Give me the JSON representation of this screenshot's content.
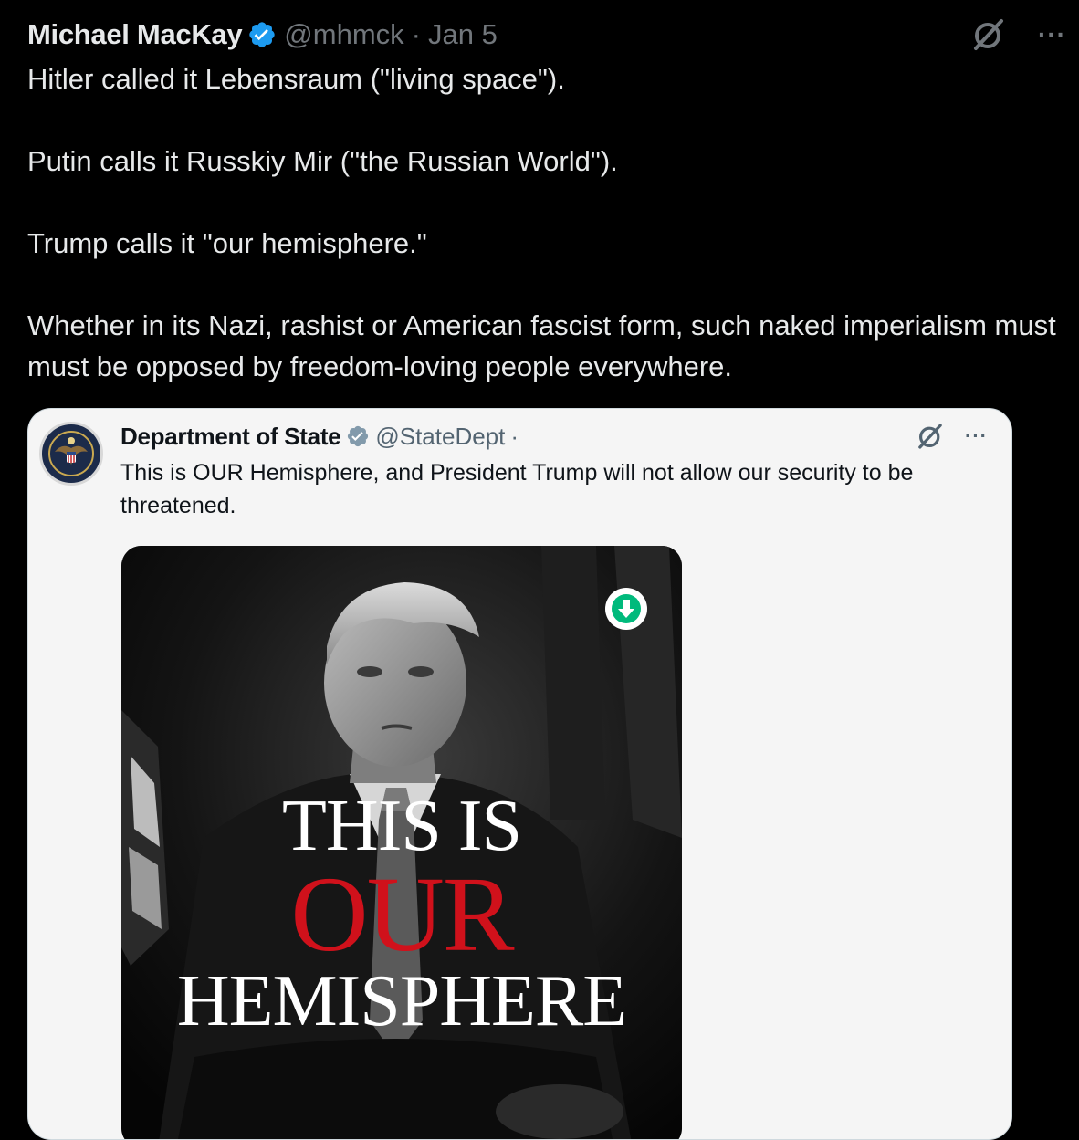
{
  "tweet": {
    "author_name": "Michael MacKay",
    "handle": "@mhmck",
    "separator": "·",
    "date": "Jan 5",
    "more_label": "···",
    "paragraphs": [
      "Hitler called it Lebensraum (\"living space\").",
      "Putin calls it Russkiy Mir (\"the Russian World\").",
      "Trump calls it \"our hemisphere.\"",
      "Whether in its Nazi, rashist or American fascist form, such naked imperialism must must be opposed by freedom-loving people everywhere."
    ]
  },
  "quote": {
    "author_name": "Department of State",
    "handle": "@StateDept",
    "separator": "·",
    "more_label": "···",
    "text": "This is OUR Hemisphere, and President Trump will not allow our security to be threatened.",
    "media": {
      "line1": "THIS IS",
      "line2": "OUR",
      "line3": "HEMISPHERE",
      "badge_icon": "download-arrow-icon"
    }
  },
  "colors": {
    "background": "#000000",
    "text_primary": "#e7e9ea",
    "text_secondary": "#71767b",
    "verified_blue": "#1d9bf0",
    "quote_verified_gray": "#829aab",
    "quote_card_bg": "#f5f5f5",
    "poster_red": "#d0111b",
    "badge_green": "#00ba7c"
  }
}
